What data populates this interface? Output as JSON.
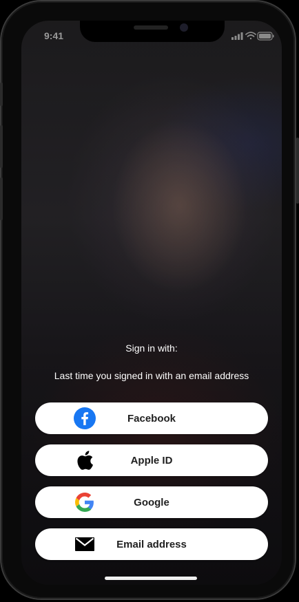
{
  "status_bar": {
    "time": "9:41",
    "icons": [
      "signal-icon",
      "wifi-icon",
      "battery-icon"
    ]
  },
  "sign_in": {
    "title": "Sign in with:",
    "subtitle": "Last time you signed in with an email address"
  },
  "buttons": [
    {
      "label": "Facebook",
      "icon": "facebook-icon",
      "color": "#1877F2"
    },
    {
      "label": "Apple ID",
      "icon": "apple-icon",
      "color": "#000000"
    },
    {
      "label": "Google",
      "icon": "google-icon",
      "color": "#4285F4"
    },
    {
      "label": "Email address",
      "icon": "mail-icon",
      "color": "#000000"
    }
  ]
}
